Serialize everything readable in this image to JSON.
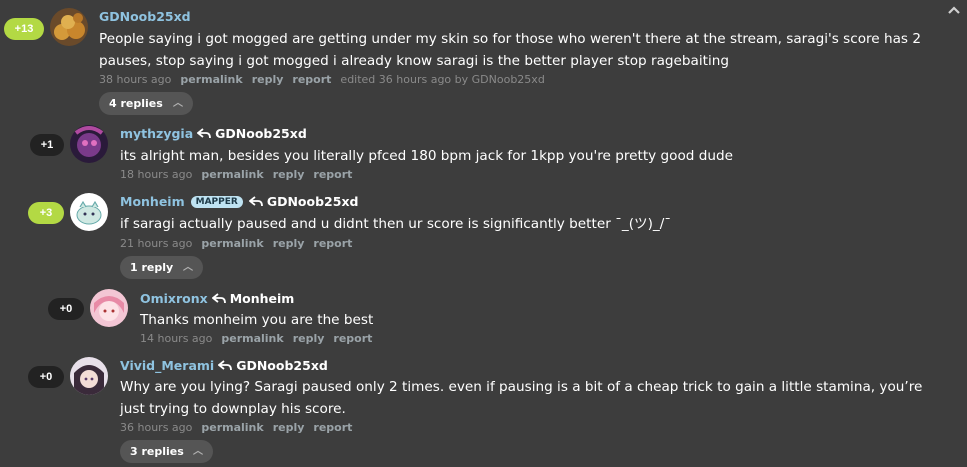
{
  "comments": [
    {
      "votes": "+13",
      "username": "GDNoob25xd",
      "body": "People saying i got mogged are getting under my skin so for those who weren't there at the stream, saragi's score has 2 pauses, stop saying i got mogged i already know saragi is the better player stop ragebaiting",
      "time": "38 hours ago",
      "permalink": "permalink",
      "reply": "reply",
      "report": "report",
      "edited": "edited 36 hours ago by GDNoob25xd",
      "replies_label": "4 replies"
    },
    {
      "votes": "+1",
      "username": "mythzygia",
      "reply_to": "GDNoob25xd",
      "body": "its alright man, besides you literally pfced 180 bpm jack for 1kpp you're pretty good dude",
      "time": "18 hours ago",
      "permalink": "permalink",
      "reply": "reply",
      "report": "report"
    },
    {
      "votes": "+3",
      "username": "Monheim",
      "badge": "MAPPER",
      "reply_to": "GDNoob25xd",
      "body": "if saragi actually paused and u didnt then ur score is significantly better ¯_(ツ)_/¯",
      "time": "21 hours ago",
      "permalink": "permalink",
      "reply": "reply",
      "report": "report",
      "replies_label": "1 reply"
    },
    {
      "votes": "+0",
      "username": "Omixronx",
      "reply_to": "Monheim",
      "body": "Thanks monheim you are the best",
      "time": "14 hours ago",
      "permalink": "permalink",
      "reply": "reply",
      "report": "report"
    },
    {
      "votes": "+0",
      "username": "Vivid_Merami",
      "reply_to": "GDNoob25xd",
      "body": "Why are you lying? Saragi paused only 2 times. even if pausing is a bit of a cheap trick to gain a little stamina, you’re just trying to downplay his score.",
      "time": "36 hours ago",
      "permalink": "permalink",
      "reply": "reply",
      "report": "report",
      "replies_label": "3 replies"
    }
  ],
  "colors": {
    "background": "#3d3d3d",
    "username": "#8fc3e0",
    "vote_positive": "#b3d944",
    "vote_neutral": "#222222",
    "meta_text": "#8a8a8a"
  },
  "icons": {
    "collapse": "chevron-up-icon",
    "reply_arrow": "reply-arrow-icon",
    "expand": "chevron-up-icon"
  }
}
